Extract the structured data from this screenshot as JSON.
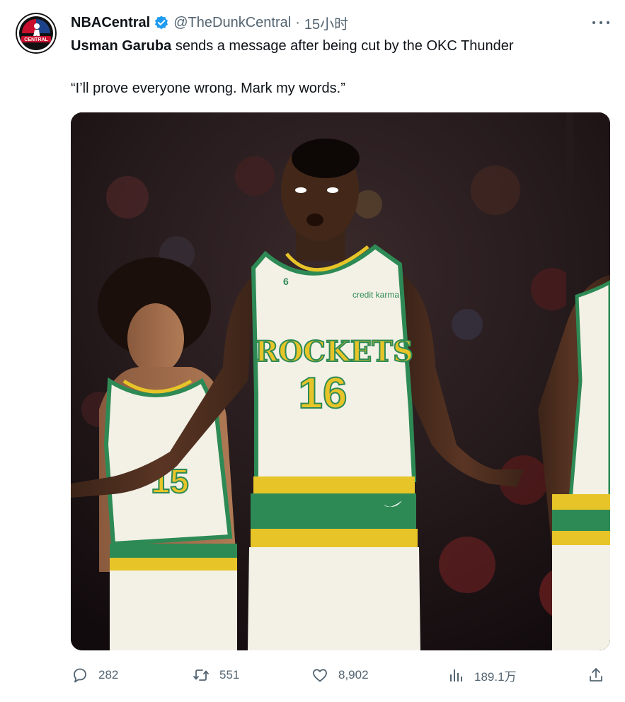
{
  "author": {
    "display_name": "NBACentral",
    "handle": "@TheDunkCentral",
    "separator": "·",
    "time": "15小时",
    "avatar_text": "CENTRAL",
    "verified": true,
    "verified_color": "#1d9bf0"
  },
  "tweet": {
    "bold_name": "Usman Garuba",
    "text_rest": " sends a message after being cut by the OKC Thunder",
    "quote": "“I’ll prove everyone wrong. Mark my words.”"
  },
  "media": {
    "jersey_text": "ROCKETS",
    "number_main": "16",
    "number_left": "15",
    "patch": "6",
    "sponsor": "credit karma",
    "jersey_color": "#f3f1e6",
    "trim_green": "#2e8a55",
    "trim_yellow": "#e7c428"
  },
  "actions": {
    "reply_count": "282",
    "retweet_count": "551",
    "like_count": "8,902",
    "views_count": "189.1万"
  },
  "icons": [
    "more-icon",
    "verified-icon",
    "reply-icon",
    "retweet-icon",
    "like-icon",
    "views-icon",
    "share-icon"
  ]
}
